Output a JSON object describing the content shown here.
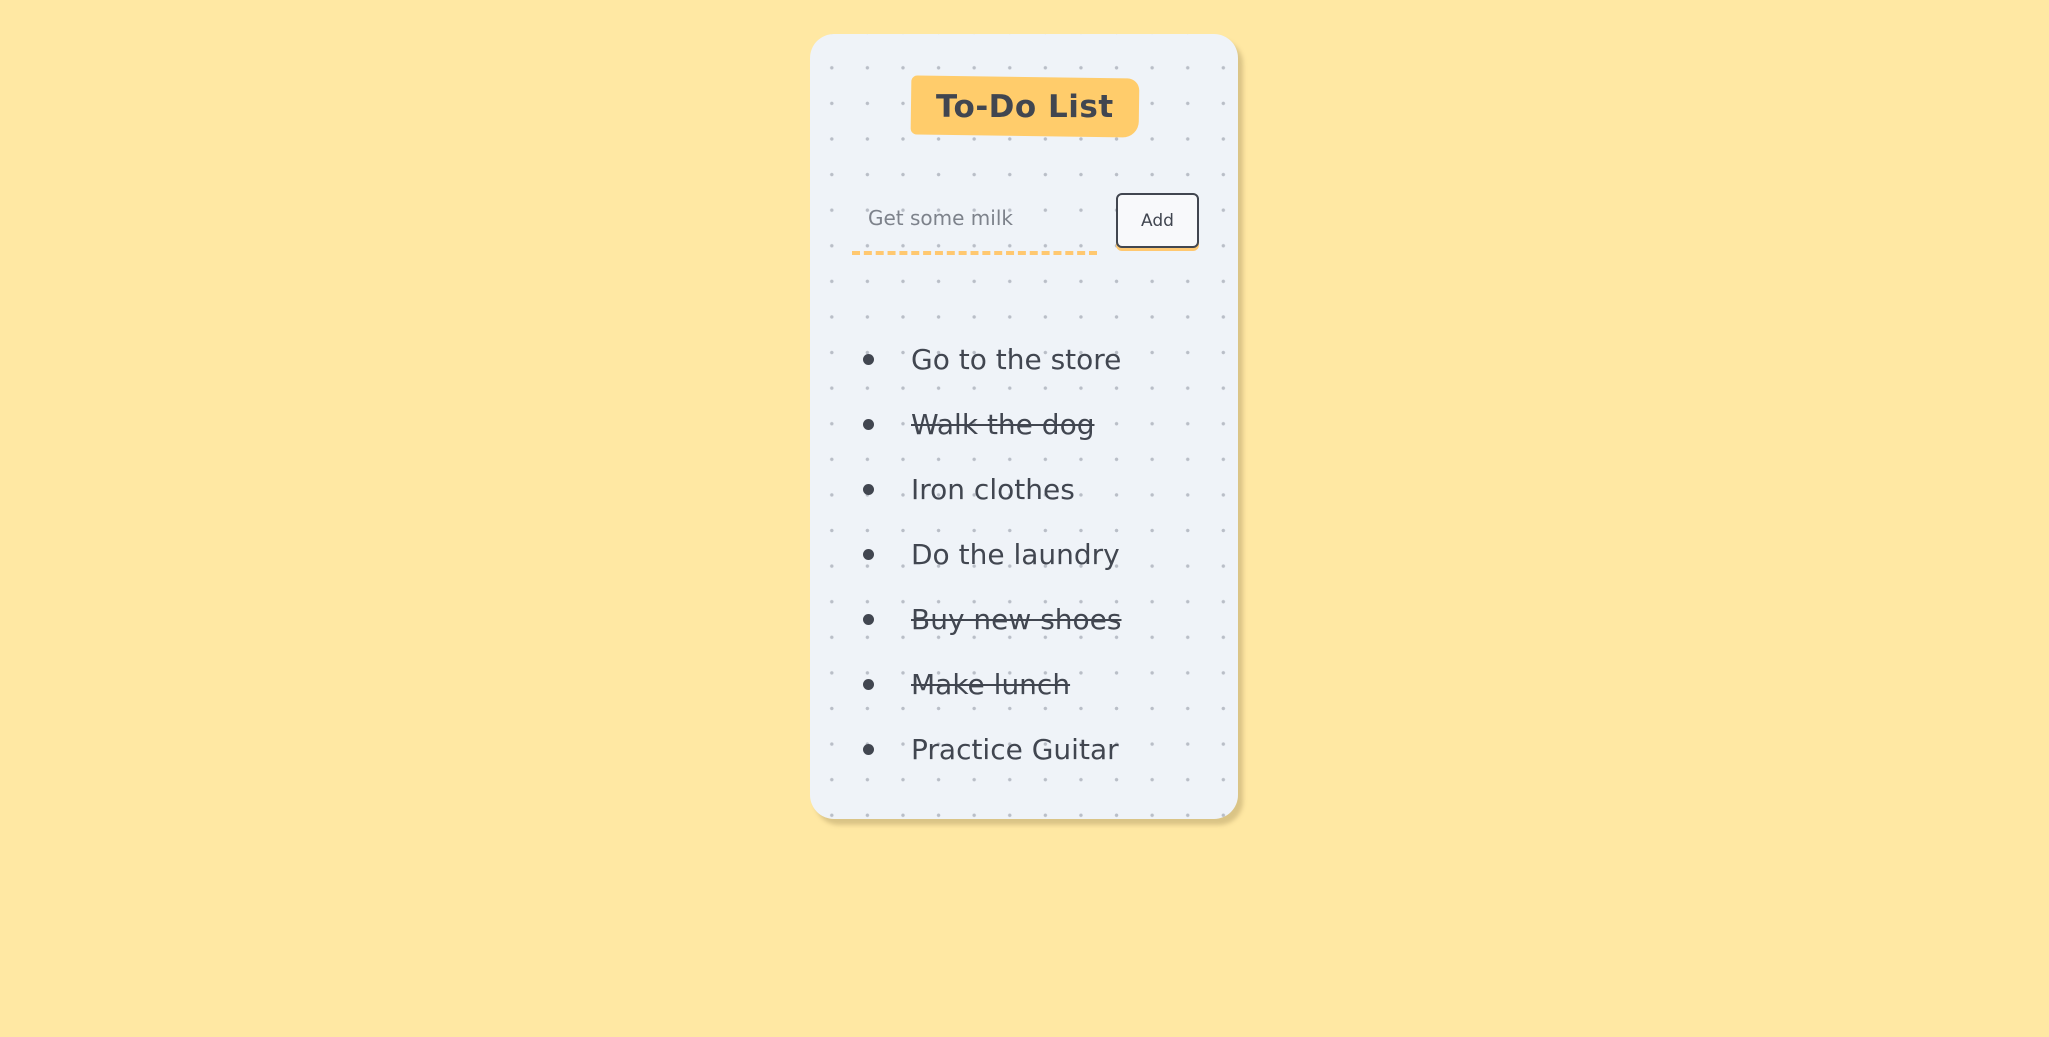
{
  "app": {
    "title": "To-Do List"
  },
  "new_task": {
    "placeholder": "Get some milk",
    "value": "",
    "add_label": "Add"
  },
  "tasks": [
    {
      "label": "Go to the store",
      "done": false
    },
    {
      "label": "Walk the dog",
      "done": true
    },
    {
      "label": "Iron clothes",
      "done": false
    },
    {
      "label": "Do the laundry",
      "done": false
    },
    {
      "label": "Buy new shoes",
      "done": true
    },
    {
      "label": "Make lunch",
      "done": true
    },
    {
      "label": "Practice Guitar",
      "done": false
    }
  ],
  "colors": {
    "page_background": "#ffe8a3",
    "card_background": "#eff3f8",
    "accent": "#ffcc6b",
    "text": "#414650"
  }
}
